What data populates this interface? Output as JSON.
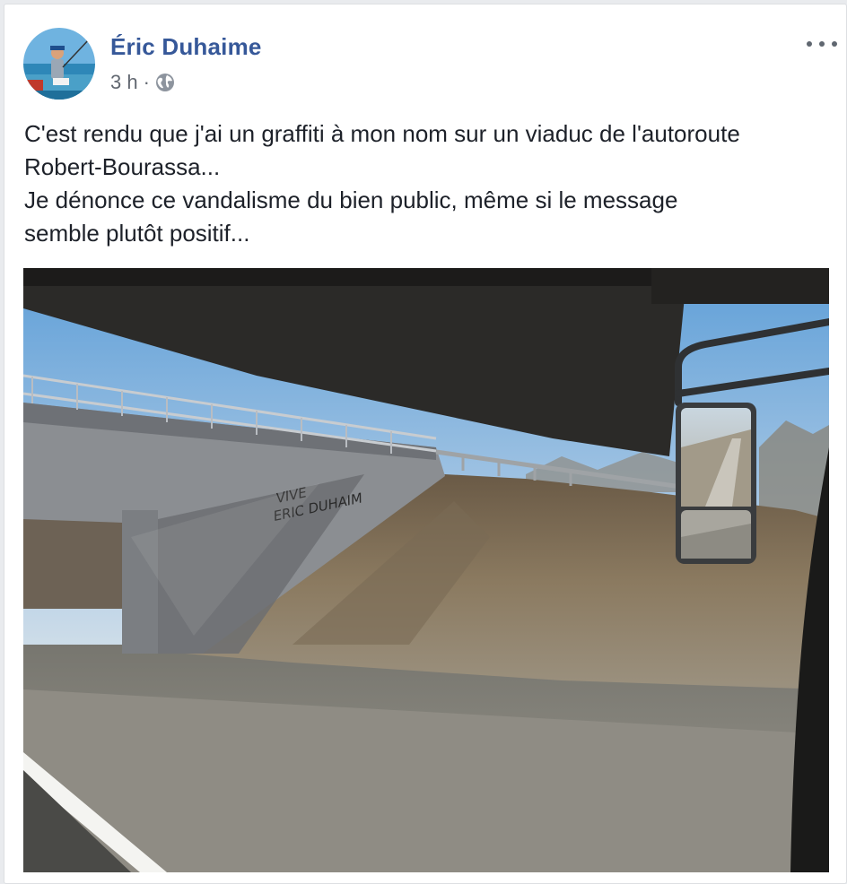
{
  "post": {
    "author": "Éric Duhaime",
    "time": "3 h",
    "separator": "·",
    "audience_icon": "globe-icon",
    "more_icon": "more-options-icon",
    "text_lines": [
      "C'est rendu que j'ai un graffiti à mon nom sur un viaduc de l'autoroute",
      "Robert-Bourassa...",
      "Je dénonce ce vandalisme du bien public, même si le message",
      "semble plutôt positif..."
    ],
    "photo": {
      "graffiti_text": [
        "VIVE",
        "ERIC DUHAIM"
      ]
    }
  },
  "colors": {
    "name_link": "#365899",
    "text": "#1d2129",
    "meta": "#616770",
    "page_bg": "#e9ebee"
  }
}
